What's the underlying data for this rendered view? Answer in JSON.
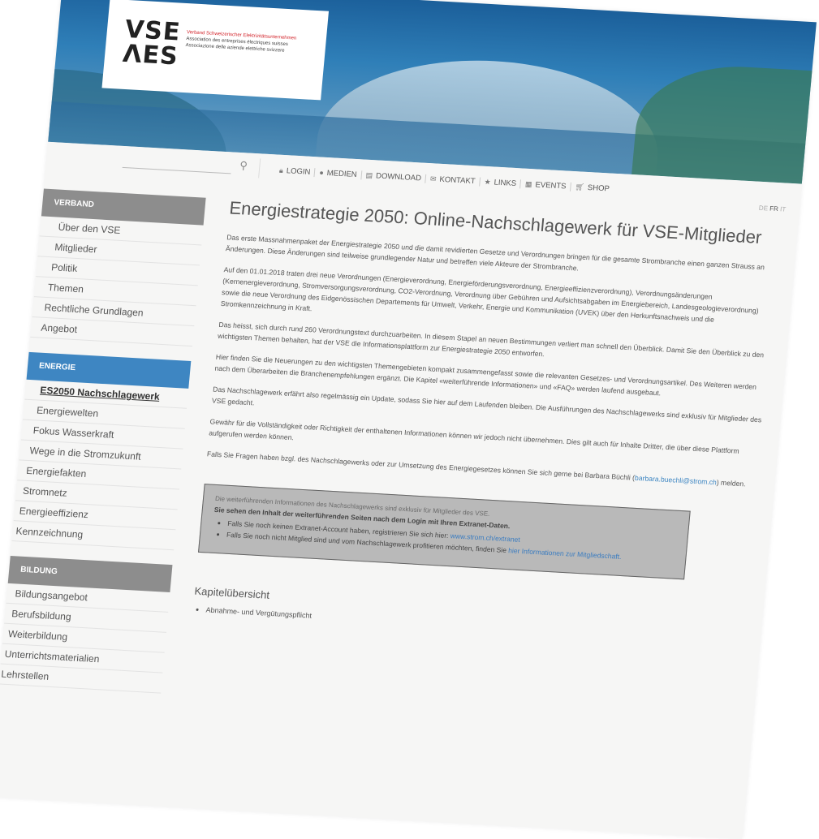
{
  "logo": {
    "line1": "VSE",
    "line2": "ΛES",
    "org_de": "Verband Schweizerischer Elektrizitätsunternehmen",
    "org_fr": "Association des entreprises électriques suisses",
    "org_it": "Associazione delle aziende elettriche svizzere"
  },
  "search": {
    "placeholder": "",
    "icon": "search-icon"
  },
  "nav": {
    "items": [
      {
        "label": "LOGIN",
        "icon": "lock-icon"
      },
      {
        "label": "MEDIEN",
        "icon": "info-circle-icon"
      },
      {
        "label": "DOWNLOAD",
        "icon": "download-icon"
      },
      {
        "label": "KONTAKT",
        "icon": "envelope-icon"
      },
      {
        "label": "LINKS",
        "icon": "star-icon"
      },
      {
        "label": "EVENTS",
        "icon": "calendar-icon"
      },
      {
        "label": "SHOP",
        "icon": "cart-icon"
      }
    ]
  },
  "languages": {
    "de": "DE",
    "fr": "FR",
    "it": "IT",
    "active": "FR"
  },
  "sidebar": {
    "verband": {
      "heading": "VERBAND",
      "items": [
        "Über den VSE",
        "Mitglieder",
        "Politik",
        "Themen",
        "Rechtliche Grundlagen",
        "Angebot"
      ]
    },
    "energie": {
      "heading": "ENERGIE",
      "items": [
        "ES2050 Nachschlagewerk",
        "Energiewelten",
        "Fokus Wasserkraft",
        "Wege in die Stromzukunft",
        "Energiefakten",
        "Stromnetz",
        "Energieeffizienz",
        "Kennzeichnung"
      ]
    },
    "bildung": {
      "heading": "BILDUNG",
      "items": [
        "Bildungsangebot",
        "Berufsbildung",
        "Weiterbildung",
        "Unterrichtsmaterialien",
        "Lehrstellen"
      ]
    }
  },
  "main": {
    "title": "Energiestrategie 2050: Online-Nachschlagewerk für VSE-Mitglieder",
    "paragraphs": [
      "Das erste Massnahmenpaket der Energiestrategie 2050 und die damit revidierten Gesetze und Verordnungen bringen für die gesamte Strombranche einen ganzen Strauss an Änderungen. Diese Änderungen sind teilweise grundlegender Natur und betreffen viele Akteure der Strombranche.",
      "Auf den 01.01.2018 traten drei neue Verordnungen (Energieverordnung, Energieförderungsverordnung, Energieeffizienzverordnung), Verordnungsänderungen (Kernenergieverordnung, Stromversorgungsverordnung, CO2-Verordnung, Verordnung über Gebühren und Aufsichtsabgaben im Energiebereich, Landesgeologieverordnung) sowie die neue Verordnung des Eidgenössischen Departements für Umwelt, Verkehr, Energie und Kommunikation (UVEK) über den Herkunftsnachweis und die Stromkennzeichnung in Kraft.",
      "Das heisst, sich durch rund 260 Verordnungstext durchzuarbeiten. In diesem Stapel an neuen Bestimmungen verliert man schnell den Überblick. Damit Sie den Überblick zu den wichtigsten Themen behalten, hat der VSE die Informationsplattform zur Energiestrategie 2050 entworfen.",
      "Hier finden Sie die Neuerungen zu den wichtigsten Themengebieten kompakt zusammengefasst sowie die relevanten Gesetzes- und Verordnungsartikel. Des Weiteren werden nach dem Überarbeiten die Branchenempfehlungen ergänzt. Die Kapitel «weiterführende Informationen» und «FAQ» werden laufend ausgebaut.",
      "Das Nachschlagewerk erfährt also regelmässig ein Update, sodass Sie hier auf dem Laufenden bleiben. Die Ausführungen des Nachschlagewerks sind exklusiv für Mitglieder des VSE gedacht.",
      "Gewähr für die Vollständigkeit oder Richtigkeit der enthaltenen Informationen können wir jedoch nicht übernehmen. Dies gilt auch für Inhalte Dritter, die über diese Plattform aufgerufen werden können."
    ],
    "contact_prefix": "Falls Sie Fragen haben bzgl. des Nachschlagewerks oder zur Umsetzung des Energiegesetzes können Sie sich gerne bei Barbara Büchli (",
    "contact_email": "barbara.buechli@strom.ch",
    "contact_suffix": ") melden."
  },
  "info_box": {
    "line1": "Die weiterführenden Informationen des Nachschlagewerks sind exklusiv für Mitglieder des VSE.",
    "line2": "Sie sehen den Inhalt der weiterführenden Seiten nach dem Login mit Ihren Extranet-Daten.",
    "bullet1_text": "Falls Sie noch keinen Extranet-Account haben, registrieren Sie sich hier: ",
    "bullet1_link": "www.strom.ch/extranet",
    "bullet2_text": "Falls Sie noch nicht Mitglied sind und vom Nachschlagewerk profitieren möchten, finden Sie ",
    "bullet2_link": "hier Informationen zur Mitgliedschaft."
  },
  "chapters": {
    "title": "Kapitelübersicht",
    "items": [
      "Abnahme- und Vergütungspflicht"
    ]
  },
  "colors": {
    "accent_blue": "#3e86c2",
    "sidebar_gray": "#8d8d8d",
    "logo_red": "#d2232a"
  }
}
